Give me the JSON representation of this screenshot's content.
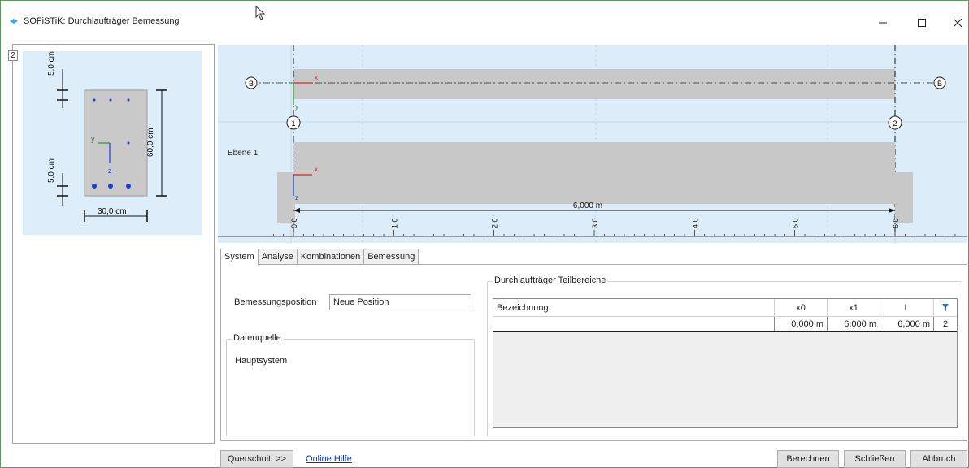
{
  "window": {
    "title": "SOFiSTiK: Durchlaufträger Bemessung",
    "icon": "sofistik-diamond-icon",
    "controls": [
      "minimize-icon",
      "maximize-icon",
      "close-icon"
    ]
  },
  "cross_section": {
    "number": "2",
    "dim_top": "5,0 cm",
    "dim_bottom": "5,0 cm",
    "dim_height": "60,0 cm",
    "dim_width": "30,0 cm",
    "axis_y": "y",
    "axis_z": "z"
  },
  "system_view": {
    "axis_label_left": "B",
    "axis_label_right": "B",
    "support_left": "1",
    "support_right": "2",
    "level_label": "Ebene 1",
    "span_label": "6,000 m",
    "axis_x": "x",
    "axis_y": "y",
    "axis_z": "z",
    "ruler_ticks": [
      "0.0",
      "1.0",
      "2.0",
      "3.0",
      "4.0",
      "5.0",
      "6.0"
    ]
  },
  "tabs": [
    {
      "label": "System",
      "active": true
    },
    {
      "label": "Analyse",
      "active": false
    },
    {
      "label": "Kombinationen",
      "active": false
    },
    {
      "label": "Bemessung",
      "active": false
    }
  ],
  "system_tab": {
    "position_label": "Bemessungsposition",
    "position_value": "Neue Position",
    "datenquelle_title": "Datenquelle",
    "datenquelle_value": "Hauptsystem",
    "teilbereiche_title": "Durchlaufträger Teilbereiche",
    "columns": [
      "Bezeichnung",
      "x0",
      "x1",
      "L"
    ],
    "filter_icon": "filter-icon",
    "rows": [
      {
        "bezeichnung": "",
        "x0": "0,000 m",
        "x1": "6,000 m",
        "L": "6,000 m",
        "n": "2"
      }
    ]
  },
  "footer": {
    "querschnitt": "Querschnitt >>",
    "hilfe": "Online Hilfe",
    "berechnen": "Berechnen",
    "schliessen": "Schließen",
    "abbruch": "Abbruch"
  },
  "colors": {
    "panel_bg": "#dcedf9",
    "beam_fill": "#c8c8c8",
    "accent_blue": "#1a3fd6",
    "axis_green": "#2a9a2a",
    "axis_red": "#e02020"
  }
}
